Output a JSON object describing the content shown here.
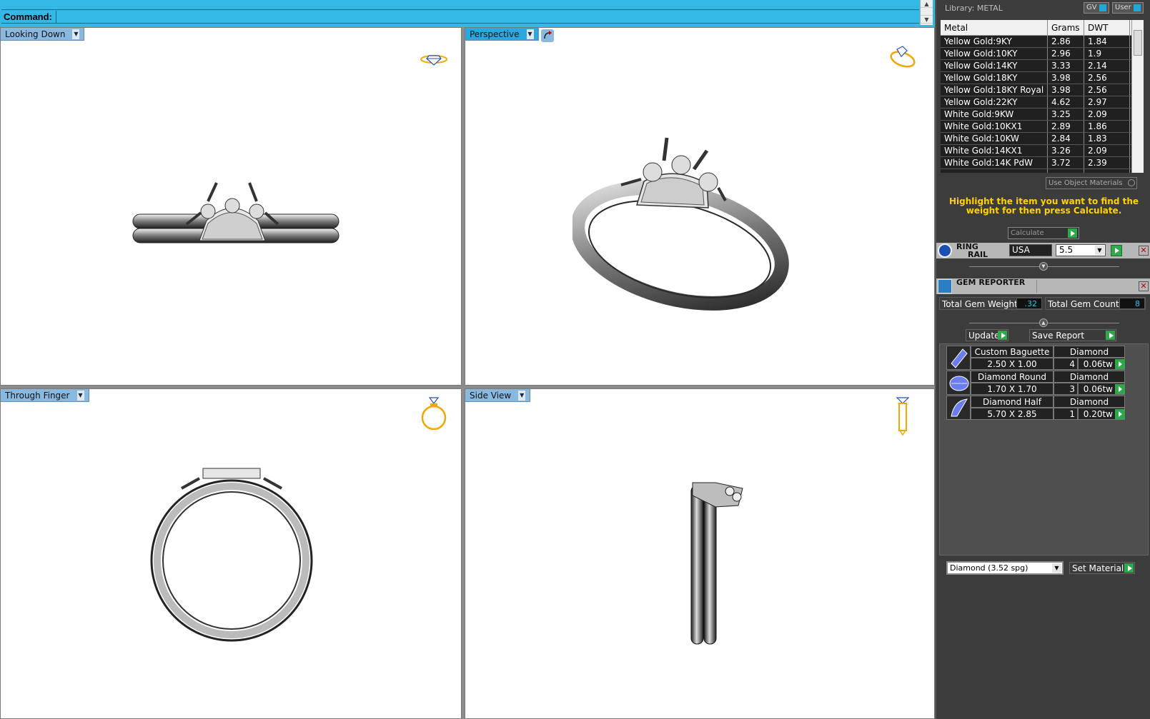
{
  "command_bar": {
    "label": "Command:"
  },
  "viewports": {
    "top_left": {
      "label": "Looking Down"
    },
    "top_right": {
      "label": "Perspective"
    },
    "bottom_left": {
      "label": "Through Finger"
    },
    "bottom_right": {
      "label": "Side View"
    }
  },
  "library": {
    "title": "Library: METAL",
    "btn_gv": "GV",
    "btn_user": "User",
    "columns": [
      "Metal",
      "Grams",
      "DWT"
    ],
    "rows": [
      [
        "Yellow Gold:9KY",
        "2.86",
        "1.84"
      ],
      [
        "Yellow Gold:10KY",
        "2.96",
        "1.9"
      ],
      [
        "Yellow Gold:14KY",
        "3.33",
        "2.14"
      ],
      [
        "Yellow Gold:18KY",
        "3.98",
        "2.56"
      ],
      [
        "Yellow Gold:18KY Royal",
        "3.98",
        "2.56"
      ],
      [
        "Yellow Gold:22KY",
        "4.62",
        "2.97"
      ],
      [
        "White Gold:9KW",
        "3.25",
        "2.09"
      ],
      [
        "White Gold:10KX1",
        "2.89",
        "1.86"
      ],
      [
        "White Gold:10KW",
        "2.84",
        "1.83"
      ],
      [
        "White Gold:14KX1",
        "3.26",
        "2.09"
      ],
      [
        "White Gold:14K PdW",
        "3.72",
        "2.39"
      ]
    ],
    "use_object_materials": "Use Object Materials",
    "instruction": "Highlight the item you want to find the weight for then press Calculate.",
    "calculate": "Calculate"
  },
  "ring_rail": {
    "title_line1": "RING",
    "title_line2": "RAIL",
    "standard": "USA",
    "size": "5.5"
  },
  "gem_reporter": {
    "title": "GEM REPORTER",
    "total_weight_label": "Total Gem Weight",
    "total_weight": ".32",
    "total_count_label": "Total Gem Count",
    "total_count": "8",
    "update": "Update",
    "save_report": "Save Report",
    "gems": [
      {
        "name": "Custom Baguette",
        "dims": "2.50 X 1.00",
        "material": "Diamond",
        "count": "4",
        "weight": "0.06tw",
        "icon": "baguette-icon"
      },
      {
        "name": "Diamond Round",
        "dims": "1.70 X 1.70",
        "material": "Diamond",
        "count": "3",
        "weight": "0.06tw",
        "icon": "round-gem-icon"
      },
      {
        "name": "Diamond Half Moon",
        "dims": "5.70 X 2.85",
        "material": "Diamond",
        "count": "1",
        "weight": "0.20tw",
        "icon": "half-moon-icon"
      }
    ],
    "material_select": "Diamond     (3.52 spg)",
    "set_material": "Set Material"
  },
  "colors": {
    "accent": "#34b8e6",
    "panel_bg": "#3c3c3c",
    "highlight_text": "#ffd200",
    "go_green": "#2fa84c"
  }
}
